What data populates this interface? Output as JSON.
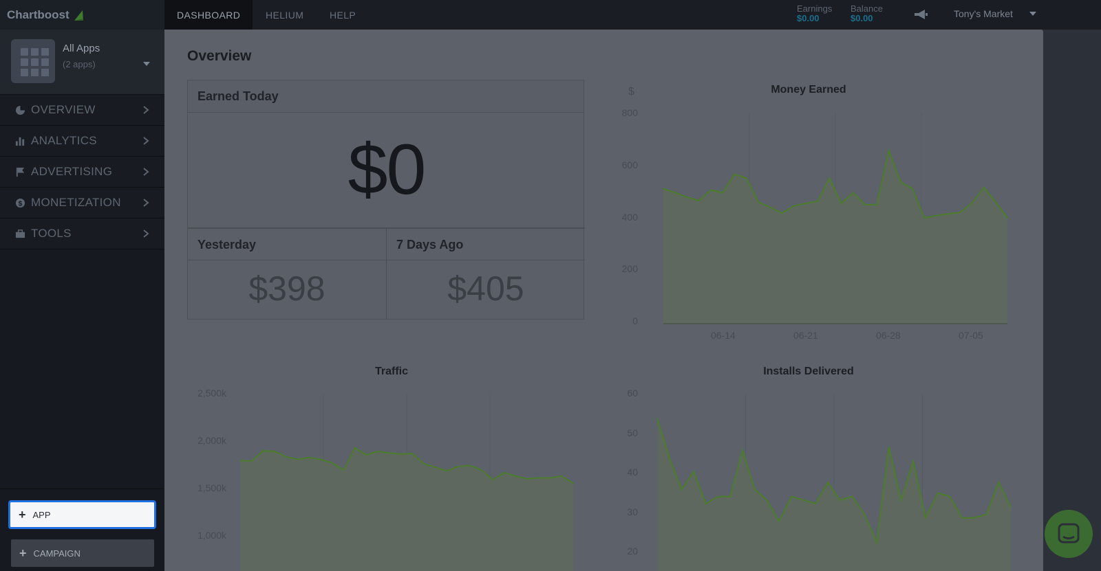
{
  "brand": {
    "name": "Chartboost"
  },
  "app_selector": {
    "title": "All Apps",
    "subtitle": "(2 apps)"
  },
  "nav": [
    {
      "label": "OVERVIEW",
      "icon": "pie-chart-icon"
    },
    {
      "label": "ANALYTICS",
      "icon": "bar-chart-icon"
    },
    {
      "label": "ADVERTISING",
      "icon": "flag-icon"
    },
    {
      "label": "MONETIZATION",
      "icon": "dollar-coin-icon"
    },
    {
      "label": "TOOLS",
      "icon": "toolbox-icon"
    }
  ],
  "actions": {
    "add_app": "APP",
    "add_campaign": "CAMPAIGN"
  },
  "topbar": {
    "tabs": [
      "DASHBOARD",
      "HELIUM",
      "HELP"
    ],
    "active_tab": "DASHBOARD",
    "earnings_label": "Earnings",
    "earnings_value": "$0.00",
    "balance_label": "Balance",
    "balance_value": "$0.00",
    "account": "Tony's Market"
  },
  "overview": {
    "title": "Overview",
    "earned_today_label": "Earned Today",
    "earned_today_value": "$0",
    "yesterday_label": "Yesterday",
    "yesterday_value": "$398",
    "seven_days_label": "7 Days Ago",
    "seven_days_value": "$405"
  },
  "chart_data": [
    {
      "type": "area",
      "title": "Money Earned",
      "ylabel": "$",
      "ylim": [
        0,
        800
      ],
      "yticks": [
        "800",
        "600",
        "400",
        "200",
        "0"
      ],
      "xticks": [
        "06-14",
        "06-21",
        "06-28",
        "07-05"
      ],
      "values": [
        510,
        495,
        478,
        465,
        505,
        495,
        565,
        550,
        460,
        440,
        418,
        445,
        455,
        462,
        550,
        455,
        495,
        450,
        450,
        655,
        535,
        510,
        400,
        408,
        415,
        420,
        455,
        515,
        460,
        400
      ]
    },
    {
      "type": "area",
      "title": "Traffic",
      "ylim": [
        500,
        2500
      ],
      "yticks": [
        "2,500k",
        "2,000k",
        "1,500k",
        "1,000k"
      ],
      "values": [
        1745,
        1740,
        1855,
        1850,
        1790,
        1760,
        1780,
        1760,
        1720,
        1640,
        1890,
        1810,
        1850,
        1830,
        1820,
        1825,
        1710,
        1670,
        1630,
        1680,
        1690,
        1640,
        1530,
        1610,
        1570,
        1540,
        1550,
        1550,
        1570,
        1490
      ]
    },
    {
      "type": "area",
      "title": "Installs Delivered",
      "ylim": [
        10,
        60
      ],
      "yticks": [
        "60",
        "50",
        "40",
        "30",
        "20"
      ],
      "values": [
        53,
        42,
        33,
        38,
        29,
        31,
        31,
        44,
        33,
        30,
        24,
        31,
        30,
        29,
        35,
        30,
        31,
        26,
        18,
        45,
        30,
        41,
        25,
        32,
        31,
        25,
        25,
        26,
        35,
        28
      ]
    }
  ]
}
